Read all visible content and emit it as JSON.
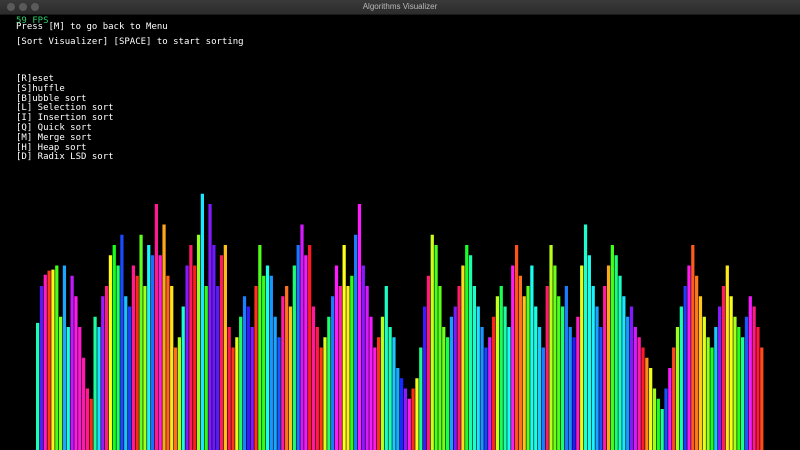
{
  "window": {
    "title": "Algorithms Visualizer"
  },
  "hud": {
    "fps": "59 FPS",
    "menu_hint": "Press [M] to go back to Menu",
    "sort_hint": "[Sort Visualizer] [SPACE] to start sorting"
  },
  "options": [
    {
      "label": "[R]eset"
    },
    {
      "label": "[S]huffle"
    },
    {
      "label": "[B]ubble sort"
    },
    {
      "label": "[L] Selection sort"
    },
    {
      "label": "[I] Insertion sort"
    },
    {
      "label": "[Q] Quick sort"
    },
    {
      "label": "[M] Merge sort"
    },
    {
      "label": "[H] Heap sort"
    },
    {
      "label": "[D] Radix LSD sort"
    }
  ],
  "colors": {
    "background": "#000000",
    "fps_text": "#2fd06a",
    "hud_text": "#ffffff"
  },
  "chart_data": {
    "type": "bar",
    "max_value": 280,
    "values": [
      124,
      160,
      171,
      175,
      176,
      180,
      130,
      180,
      120,
      170,
      150,
      120,
      90,
      60,
      50,
      130,
      120,
      150,
      160,
      190,
      200,
      180,
      210,
      150,
      140,
      180,
      170,
      210,
      160,
      200,
      190,
      240,
      190,
      220,
      170,
      160,
      100,
      110,
      140,
      180,
      200,
      180,
      210,
      250,
      160,
      240,
      200,
      160,
      190,
      200,
      120,
      100,
      110,
      130,
      150,
      140,
      120,
      160,
      200,
      170,
      180,
      170,
      130,
      110,
      150,
      160,
      140,
      180,
      200,
      220,
      190,
      200,
      140,
      120,
      100,
      110,
      130,
      150,
      180,
      160,
      200,
      160,
      170,
      210,
      240,
      180,
      160,
      130,
      100,
      110,
      130,
      160,
      120,
      110,
      80,
      70,
      60,
      50,
      60,
      70,
      100,
      140,
      170,
      210,
      200,
      160,
      120,
      110,
      130,
      140,
      160,
      180,
      200,
      190,
      160,
      140,
      120,
      100,
      110,
      130,
      150,
      160,
      140,
      120,
      180,
      200,
      170,
      150,
      160,
      180,
      140,
      120,
      100,
      160,
      200,
      180,
      150,
      140,
      160,
      120,
      110,
      130,
      180,
      220,
      190,
      160,
      140,
      120,
      160,
      180,
      200,
      190,
      170,
      150,
      130,
      140,
      120,
      110,
      100,
      90,
      80,
      60,
      50,
      40,
      60,
      80,
      100,
      120,
      140,
      160,
      180,
      200,
      170,
      150,
      130,
      110,
      100,
      120,
      140,
      160,
      180,
      150,
      130,
      120,
      110,
      130,
      150,
      140,
      120,
      100
    ]
  }
}
